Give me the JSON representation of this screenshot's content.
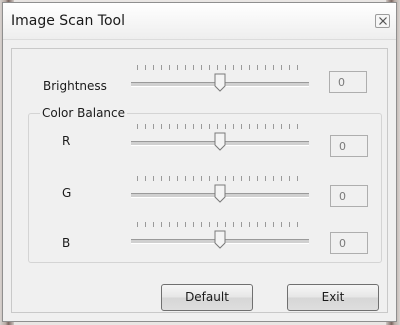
{
  "window": {
    "title": "Image Scan Tool"
  },
  "controls": {
    "brightness": {
      "label": "Brightness",
      "value": "0",
      "level": 0.5
    },
    "color_balance": {
      "title": "Color Balance",
      "r": {
        "label": "R",
        "value": "0",
        "level": 0.5
      },
      "g": {
        "label": "G",
        "value": "0",
        "level": 0.5
      },
      "b": {
        "label": "B",
        "value": "0",
        "level": 0.5
      }
    }
  },
  "buttons": {
    "default_label": "Default",
    "exit_label": "Exit"
  },
  "icons": {
    "close": "close-icon"
  }
}
